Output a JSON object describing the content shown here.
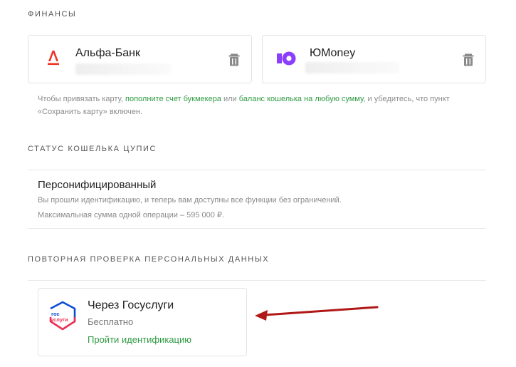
{
  "finances": {
    "title": "ФИНАНСЫ",
    "cards": [
      {
        "name": "Альфа-Банк",
        "icon": "alfa-bank-logo-icon",
        "brand_color": "#ef3124"
      },
      {
        "name": "ЮMoney",
        "icon": "yoomoney-logo-icon",
        "brand_color": "#8b3ffd"
      }
    ],
    "note": {
      "part1": "Чтобы привязать карту, ",
      "link1": "пополните счет букмекера",
      "part2": " или ",
      "link2": "баланс кошелька на любую сумму",
      "part3": ", и убедитесь, что пункт «Сохранить карту» включен."
    }
  },
  "wallet_status": {
    "title": "СТАТУС КОШЕЛЬКА ЦУПИС",
    "status": "Персонифицированный",
    "desc1": "Вы прошли идентификацию, и теперь вам доступны все функции без ограничений.",
    "desc2": "Максимальная сумма одной операции – 595 000 ₽."
  },
  "recheck": {
    "title": "ПОВТОРНАЯ ПРОВЕРКА ПЕРСОНАЛЬНЫХ ДАННЫХ",
    "option": {
      "title": "Через Госуслуги",
      "price": "Бесплатно",
      "action": "Пройти идентификацию",
      "logo_text_top": "гос",
      "logo_text_bottom": "услуги"
    }
  },
  "colors": {
    "link_green": "#2e9a41",
    "arrow_red": "#b01818",
    "gos_blue": "#0d4cd3",
    "gos_red": "#ee2f53"
  }
}
